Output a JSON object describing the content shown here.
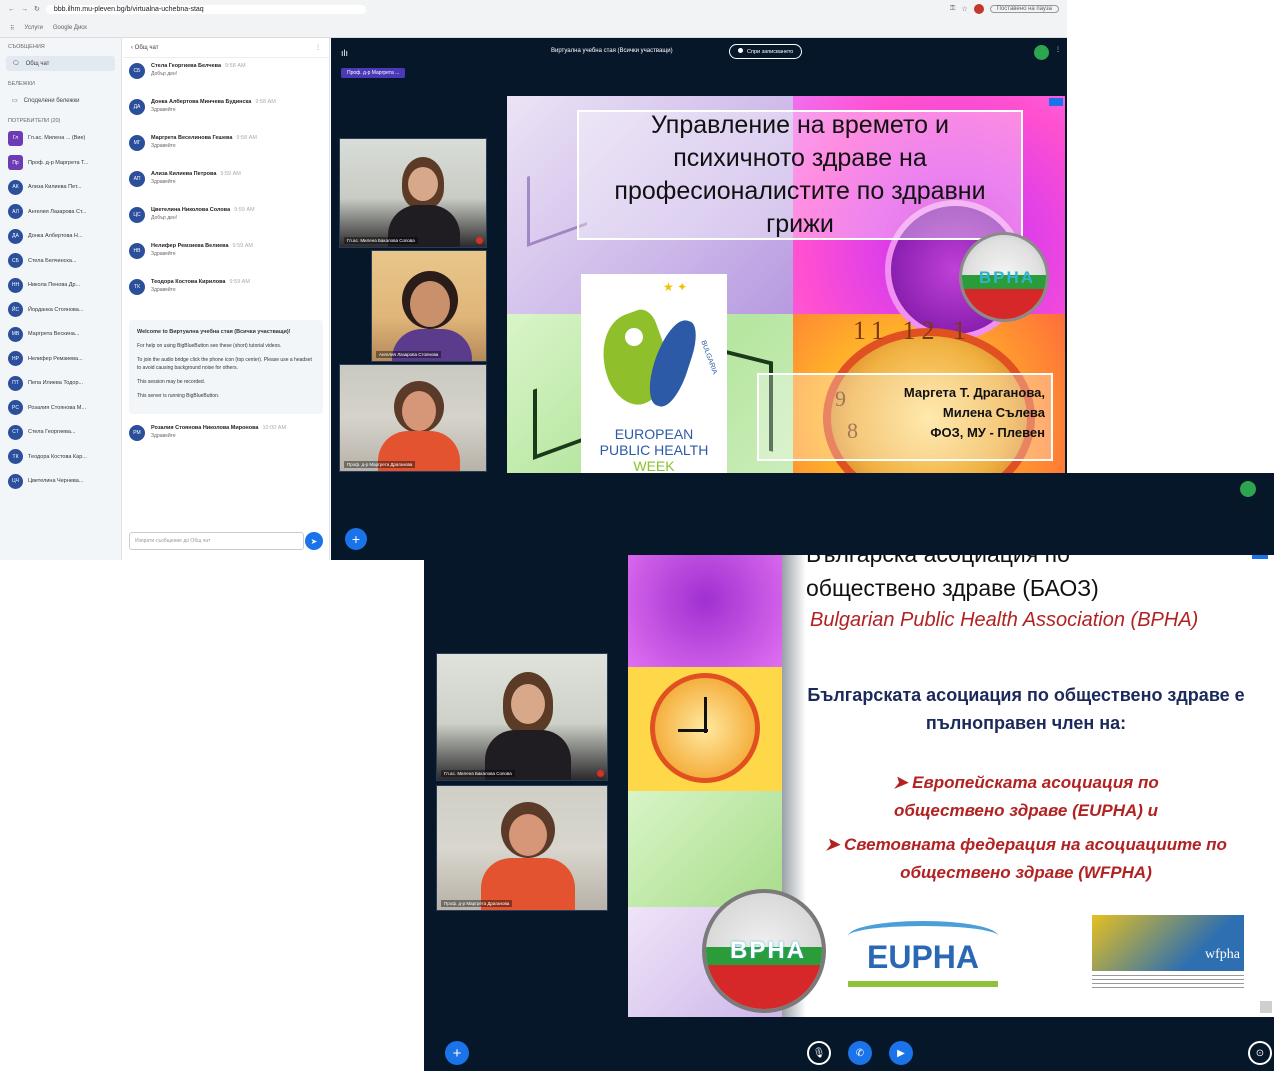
{
  "browser": {
    "url": "bbb.ilhm.mu-pleven.bg/b/virtualna-uchebna-staq",
    "paused": "Поставено на пауза",
    "bookmarks": [
      "Услуги",
      "Google Диск"
    ]
  },
  "sidebar": {
    "messages_header": "Съобщения",
    "public_chat": "Общ чат",
    "notes_header": "Бележки",
    "shared_notes": "Споделени бележки",
    "users_header": "Потребители (20)",
    "users": [
      {
        "initials": "Гл",
        "name": "Гл.ас. Милена ... (Вие)",
        "square": true
      },
      {
        "initials": "Пр",
        "name": "Проф. д-р Маргрета Т...",
        "square": true
      },
      {
        "initials": "АК",
        "name": "Ализа Килиева Пет..."
      },
      {
        "initials": "АЛ",
        "name": "Ангелия Лазарова Ст..."
      },
      {
        "initials": "ДА",
        "name": "Донка Албертова Н..."
      },
      {
        "initials": "СБ",
        "name": "Стела Белчинска..."
      },
      {
        "initials": "НН",
        "name": "Никола Пенова Др..."
      },
      {
        "initials": "ЙС",
        "name": "Йорданка Стоянова..."
      },
      {
        "initials": "МВ",
        "name": "Маргрета Вескина..."
      },
      {
        "initials": "НР",
        "name": "Нелифер Ремзиева..."
      },
      {
        "initials": "ПТ",
        "name": "Пепа Илиева Тодор..."
      },
      {
        "initials": "РС",
        "name": "Розалия Стоянова М..."
      },
      {
        "initials": "СТ",
        "name": "Стела Георгиева..."
      },
      {
        "initials": "ТК",
        "name": "Теодора Костова Кар..."
      },
      {
        "initials": "ЦЧ",
        "name": "Цветелина Чернева..."
      }
    ]
  },
  "chat": {
    "header": "Общ чат",
    "messages": [
      {
        "initials": "СБ",
        "name": "Стела Георгиева Белчева",
        "time": "9:58 AM",
        "text": "Добър ден!"
      },
      {
        "initials": "ДА",
        "name": "Донка Албертова Минчева Будинска",
        "time": "9:58 AM",
        "text": "Здравейте"
      },
      {
        "initials": "МГ",
        "name": "Маргрета Веселинова Гешева",
        "time": "9:58 AM",
        "text": "Здравейте"
      },
      {
        "initials": "АП",
        "name": "Ализа Килиева Петрова",
        "time": "9:59 AM",
        "text": "Здравейте"
      },
      {
        "initials": "ЦС",
        "name": "Цветелина Николова Солова",
        "time": "9:59 AM",
        "text": "Добър ден!"
      },
      {
        "initials": "НВ",
        "name": "Нелифер Ремзиева Велиева",
        "time": "9:59 AM",
        "text": "Здравейте"
      },
      {
        "initials": "ТК",
        "name": "Теодора Костова Кирилова",
        "time": "9:59 AM",
        "text": "Здравейте"
      }
    ],
    "welcome": {
      "title": "Welcome to Виртуална учебна стая (Всички участващи)!",
      "help": "For help on using BigBlueButton see these (short) tutorial videos.",
      "audio": "To join the audio bridge click the phone icon (top center). Please use a headset to avoid causing background noise for others.",
      "recorded": "This session may be recorded.",
      "server": "This server is running BigBlueButton."
    },
    "last_message": {
      "initials": "РМ",
      "name": "Розалия Стоянова Николова Миронова",
      "time": "10:00 AM",
      "text": "Здравейте"
    },
    "input_placeholder": "Изпрати съобщение до Общ чат"
  },
  "meeting": {
    "title": "Виртуална учебна стая (Всички участващи)",
    "recording_label": "Спри записването",
    "presenter": "Проф. д-р Маргрета ..."
  },
  "videos_shot1": [
    {
      "name": "Гл.ас. Милена Бакалова Сопова"
    },
    {
      "name": "Ангелия Лазарова Стоянова"
    },
    {
      "name": "Проф. д-р Маргрета Драганова"
    }
  ],
  "slide1": {
    "title": "Управление на времето и психичното здраве на професионалистите по здравни грижи",
    "ephw_lines": [
      "EUROPEAN",
      "PUBLIC HEALTH",
      "WEEK"
    ],
    "bulgaria": "BULGARIA",
    "bpha": "BPHA",
    "authors": [
      "Маргета Т. Драганова,",
      "Милена Сълева",
      "ФОЗ, МУ - Плевен"
    ]
  },
  "videos_shot2": [
    {
      "name": "Гл.ас. Милена Бакалова Сопова"
    },
    {
      "name": "Проф. д-р Маргрета Драганова"
    }
  ],
  "slide2": {
    "heading_partial": "Българска асоциация по",
    "heading2": "обществено здраве (БАОЗ)",
    "english": "Bulgarian Public Health Association (BPHA)",
    "member_text": "Българската асоциация по обществено здраве е пълноправен член на:",
    "bullet1": "Европейската асоциация по обществено здраве (EUPHA) и",
    "bullet2": "Световната федерация на асоциациите по обществено здраве (WFPHA)",
    "bpha_logo": "BPHA",
    "eupha_logo": "EUPHA",
    "wfpha_logo": "wfpha"
  },
  "colors": {
    "stage_bg": "#06172a",
    "accent_blue": "#1a73e8",
    "slide_title_border": "#ffffff",
    "red_text": "#b22222",
    "navy_text": "#1b2a5a"
  },
  "icons": [
    "plus-icon",
    "microphone-icon",
    "phone-icon",
    "camera-icon",
    "screen-share-icon",
    "send-icon",
    "users-icon",
    "more-icon"
  ]
}
